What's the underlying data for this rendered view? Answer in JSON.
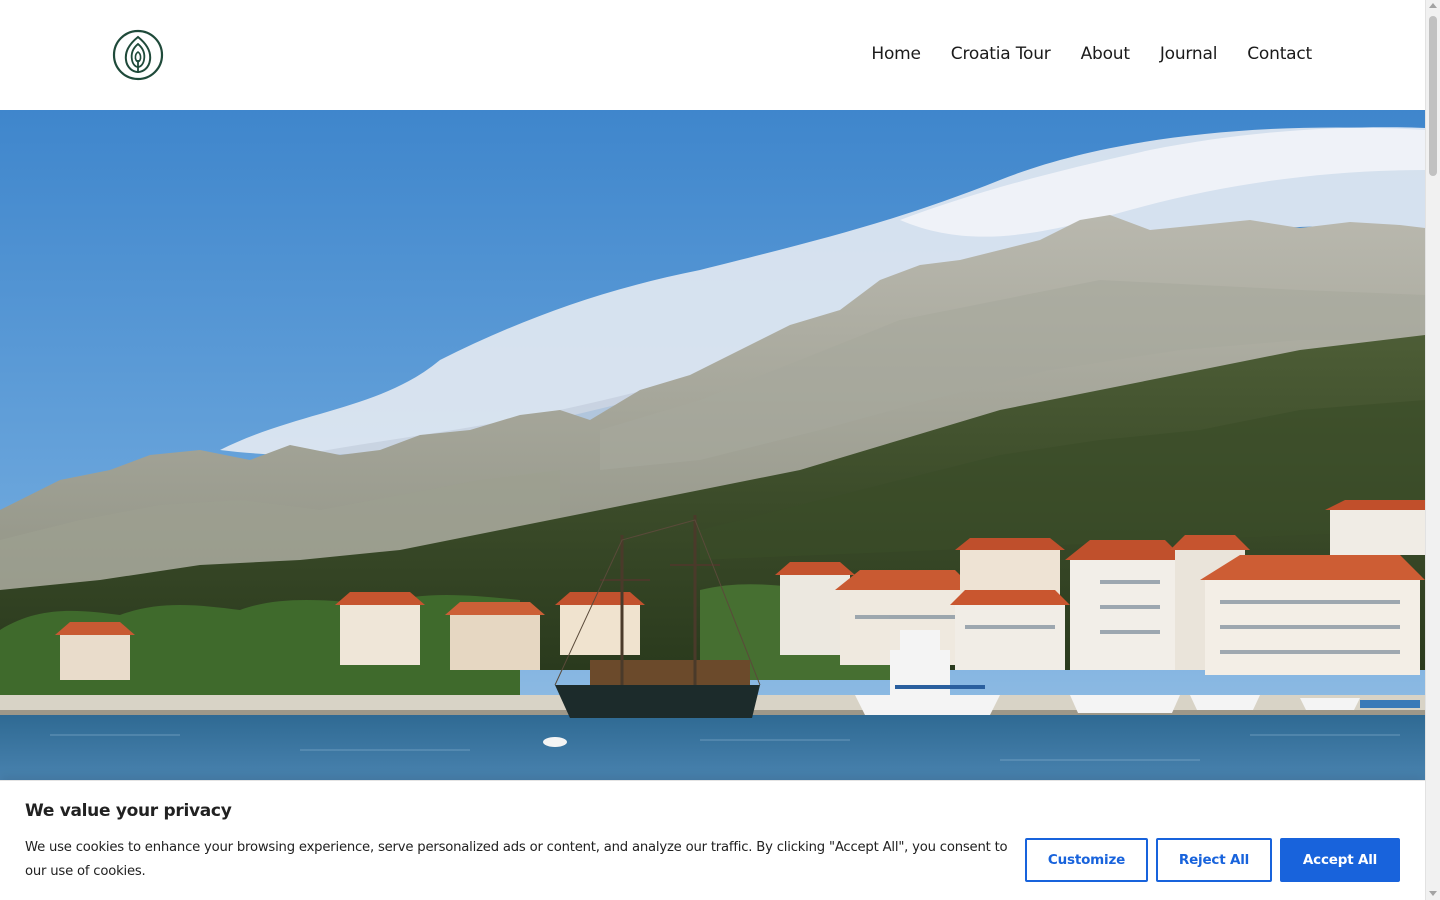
{
  "header": {
    "logo_icon": "leaf-logo-icon",
    "nav": [
      {
        "label": "Home"
      },
      {
        "label": "Croatia Tour"
      },
      {
        "label": "About"
      },
      {
        "label": "Journal"
      },
      {
        "label": "Contact"
      }
    ]
  },
  "hero": {
    "image": "coastal-town-mountains-photo"
  },
  "cookie_banner": {
    "title": "We value your privacy",
    "text": "We use cookies to enhance your browsing experience, serve personalized ads or content, and analyze our traffic. By clicking \"Accept All\", you consent to our use of cookies.",
    "customize_label": "Customize",
    "reject_label": "Reject All",
    "accept_label": "Accept All"
  },
  "colors": {
    "brand_green": "#1f4a3a",
    "button_blue": "#1863dc",
    "text": "#212121"
  }
}
